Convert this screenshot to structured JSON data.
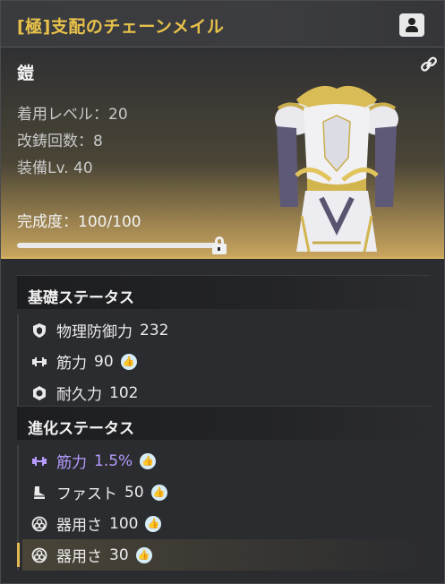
{
  "header": {
    "title": "[極]支配のチェーンメイル"
  },
  "hero": {
    "category": "鎧",
    "stats": [
      "着用レベル：20",
      "改鋳回数：8",
      "装備Lv. 40"
    ],
    "completion": "完成度：100/100",
    "progress": 1.0
  },
  "basic": {
    "title": "基礎ステータス",
    "rows": [
      {
        "label": "物理防御力",
        "value": "232",
        "icon": "shield-icon",
        "thumb": false
      },
      {
        "label": "筋力",
        "value": "90",
        "icon": "dumbbell-icon",
        "thumb": true
      },
      {
        "label": "耐久力",
        "value": "102",
        "icon": "durability-icon",
        "thumb": false
      }
    ]
  },
  "evolution": {
    "title": "進化ステータス",
    "rows": [
      {
        "label": "筋力",
        "value": "1.5%",
        "icon": "dumbbell-icon",
        "thumb": true,
        "color": "#b69bff"
      },
      {
        "label": "ファスト",
        "value": "50",
        "icon": "boot-icon",
        "thumb": true
      },
      {
        "label": "器用さ",
        "value": "100",
        "icon": "dexterity-icon",
        "thumb": true
      },
      {
        "label": "器用さ",
        "value": "30",
        "icon": "dexterity-icon",
        "thumb": true
      }
    ]
  },
  "colors": {
    "title": "#e8c24a",
    "accent": "#d7b45f",
    "purple": "#b69bff"
  }
}
